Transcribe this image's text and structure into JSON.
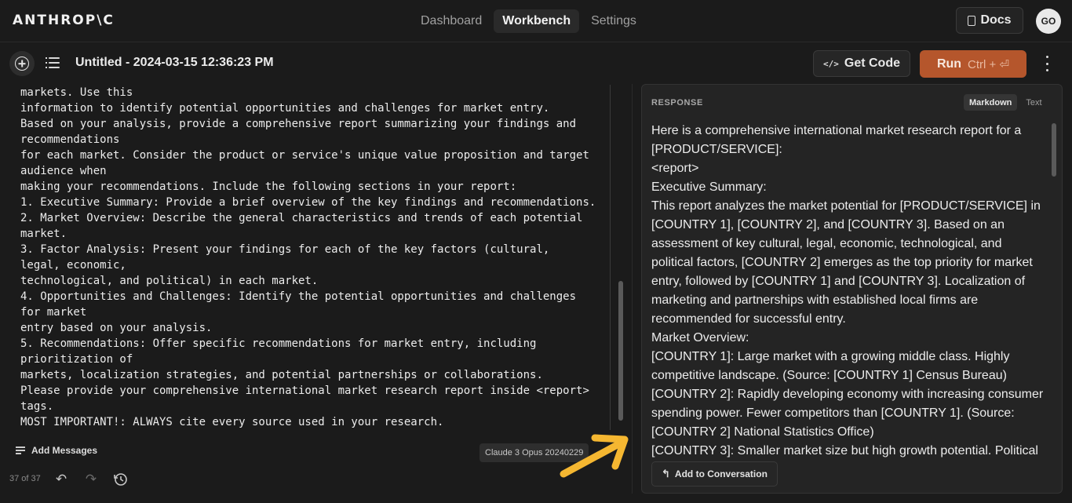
{
  "brand": "ANTHROP\\C",
  "nav": {
    "tabs": [
      {
        "label": "Dashboard"
      },
      {
        "label": "Workbench"
      },
      {
        "label": "Settings"
      }
    ],
    "docs_label": "Docs",
    "avatar_initials": "GO"
  },
  "toolbar": {
    "title": "Untitled - 2024-03-15 12:36:23 PM",
    "get_code_label": "Get Code",
    "run_label": "Run",
    "run_shortcut": "Ctrl + ⏎"
  },
  "prompt": {
    "lines": [
      "markets. Use this",
      "information to identify potential opportunities and challenges for market entry.",
      "Based on your analysis, provide a comprehensive report summarizing your findings and",
      "recommendations",
      "for each market. Consider the product or service's unique value proposition and target",
      "audience when",
      "making your recommendations. Include the following sections in your report:",
      "1. Executive Summary: Provide a brief overview of the key findings and recommendations.",
      "2. Market Overview: Describe the general characteristics and trends of each potential",
      "market.",
      "3. Factor Analysis: Present your findings for each of the key factors (cultural,",
      "legal, economic,",
      "technological, and political) in each market.",
      "4. Opportunities and Challenges: Identify the potential opportunities and challenges",
      "for market",
      "entry based on your analysis.",
      "5. Recommendations: Offer specific recommendations for market entry, including",
      "prioritization of",
      "markets, localization strategies, and potential partnerships or collaborations.",
      "Please provide your comprehensive international market research report inside <report>",
      "tags.",
      "MOST IMPORTANT!: ALWAYS cite every source used in your research."
    ],
    "add_messages_label": "Add Messages",
    "model_badge": "Claude 3 Opus 20240229",
    "page_count": "37 of 37"
  },
  "response": {
    "label": "RESPONSE",
    "formats": [
      {
        "label": "Markdown"
      },
      {
        "label": "Text"
      }
    ],
    "lines": [
      "Here is a comprehensive international market research report for a",
      "[PRODUCT/SERVICE]:",
      "<report>",
      "Executive Summary:",
      "This report analyzes the market potential for [PRODUCT/SERVICE] in",
      "[COUNTRY 1], [COUNTRY 2], and [COUNTRY 3]. Based on an",
      "assessment of key cultural, legal, economic, technological, and",
      "political factors, [COUNTRY 2] emerges as the top priority for market",
      "entry, followed by [COUNTRY 1] and [COUNTRY 3]. Localization of",
      "marketing and partnerships with established local firms are",
      "recommended for successful entry.",
      "Market Overview:",
      "[COUNTRY 1]: Large market with a growing middle class. Highly",
      "competitive landscape. (Source: [COUNTRY 1] Census Bureau)",
      "[COUNTRY 2]: Rapidly developing economy with increasing consumer",
      "spending power. Fewer competitors than [COUNTRY 1]. (Source:",
      "[COUNTRY 2] National Statistics Office)",
      "[COUNTRY 3]: Smaller market size but high growth potential. Political"
    ],
    "add_to_conversation_label": "Add to Conversation"
  },
  "colors": {
    "background": "#1b1b1b",
    "run_button": "#b5562c",
    "arrow": "#f5b731"
  },
  "icons": [
    "new-prompt-icon",
    "list-icon",
    "docs-icon",
    "code-icon",
    "kebab-menu-icon",
    "add-messages-icon",
    "undo-icon",
    "redo-icon",
    "history-icon",
    "reply-icon",
    "arrow-annotation"
  ]
}
